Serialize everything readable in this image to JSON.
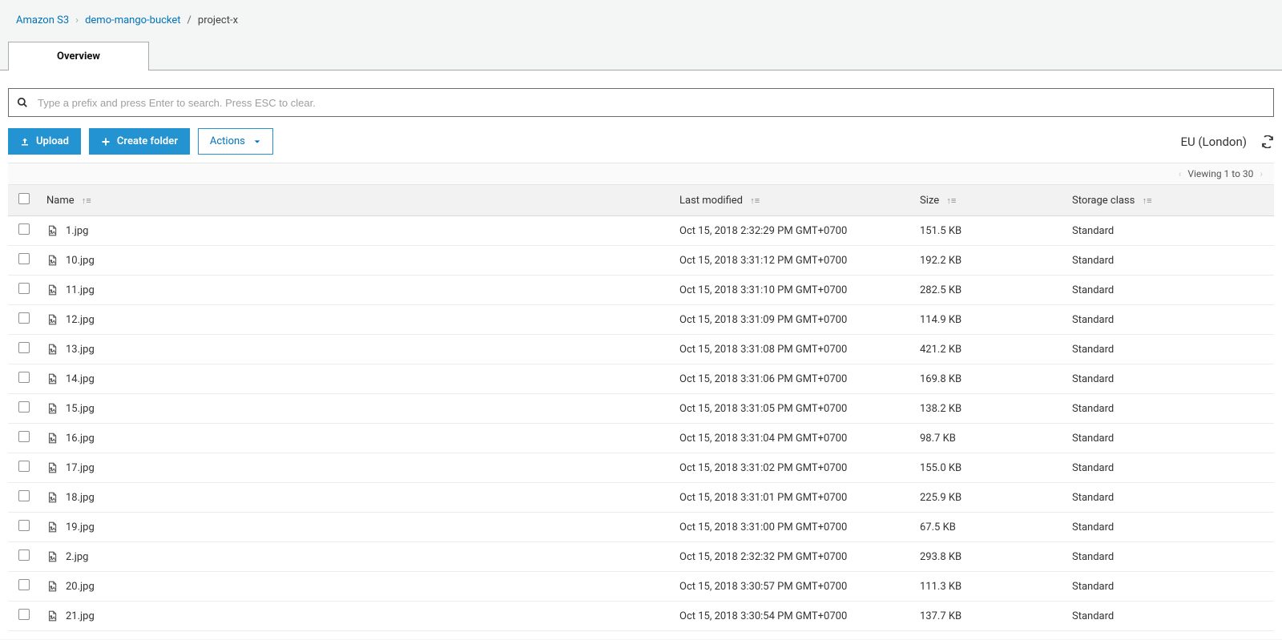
{
  "breadcrumb": {
    "root": "Amazon S3",
    "bucket": "demo-mango-bucket",
    "folder": "project-x"
  },
  "tabs": {
    "overview": "Overview"
  },
  "search": {
    "placeholder": "Type a prefix and press Enter to search. Press ESC to clear."
  },
  "toolbar": {
    "upload": "Upload",
    "create_folder": "Create folder",
    "actions": "Actions",
    "region": "EU (London)"
  },
  "pagination": {
    "viewing": "Viewing 1 to 30"
  },
  "columns": {
    "name": "Name",
    "last_modified": "Last modified",
    "size": "Size",
    "storage_class": "Storage class"
  },
  "files": [
    {
      "name": "1.jpg",
      "modified": "Oct 15, 2018 2:32:29 PM GMT+0700",
      "size": "151.5 KB",
      "storage": "Standard"
    },
    {
      "name": "10.jpg",
      "modified": "Oct 15, 2018 3:31:12 PM GMT+0700",
      "size": "192.2 KB",
      "storage": "Standard"
    },
    {
      "name": "11.jpg",
      "modified": "Oct 15, 2018 3:31:10 PM GMT+0700",
      "size": "282.5 KB",
      "storage": "Standard"
    },
    {
      "name": "12.jpg",
      "modified": "Oct 15, 2018 3:31:09 PM GMT+0700",
      "size": "114.9 KB",
      "storage": "Standard"
    },
    {
      "name": "13.jpg",
      "modified": "Oct 15, 2018 3:31:08 PM GMT+0700",
      "size": "421.2 KB",
      "storage": "Standard"
    },
    {
      "name": "14.jpg",
      "modified": "Oct 15, 2018 3:31:06 PM GMT+0700",
      "size": "169.8 KB",
      "storage": "Standard"
    },
    {
      "name": "15.jpg",
      "modified": "Oct 15, 2018 3:31:05 PM GMT+0700",
      "size": "138.2 KB",
      "storage": "Standard"
    },
    {
      "name": "16.jpg",
      "modified": "Oct 15, 2018 3:31:04 PM GMT+0700",
      "size": "98.7 KB",
      "storage": "Standard"
    },
    {
      "name": "17.jpg",
      "modified": "Oct 15, 2018 3:31:02 PM GMT+0700",
      "size": "155.0 KB",
      "storage": "Standard"
    },
    {
      "name": "18.jpg",
      "modified": "Oct 15, 2018 3:31:01 PM GMT+0700",
      "size": "225.9 KB",
      "storage": "Standard"
    },
    {
      "name": "19.jpg",
      "modified": "Oct 15, 2018 3:31:00 PM GMT+0700",
      "size": "67.5 KB",
      "storage": "Standard"
    },
    {
      "name": "2.jpg",
      "modified": "Oct 15, 2018 2:32:32 PM GMT+0700",
      "size": "293.8 KB",
      "storage": "Standard"
    },
    {
      "name": "20.jpg",
      "modified": "Oct 15, 2018 3:30:57 PM GMT+0700",
      "size": "111.3 KB",
      "storage": "Standard"
    },
    {
      "name": "21.jpg",
      "modified": "Oct 15, 2018 3:30:54 PM GMT+0700",
      "size": "137.7 KB",
      "storage": "Standard"
    }
  ]
}
